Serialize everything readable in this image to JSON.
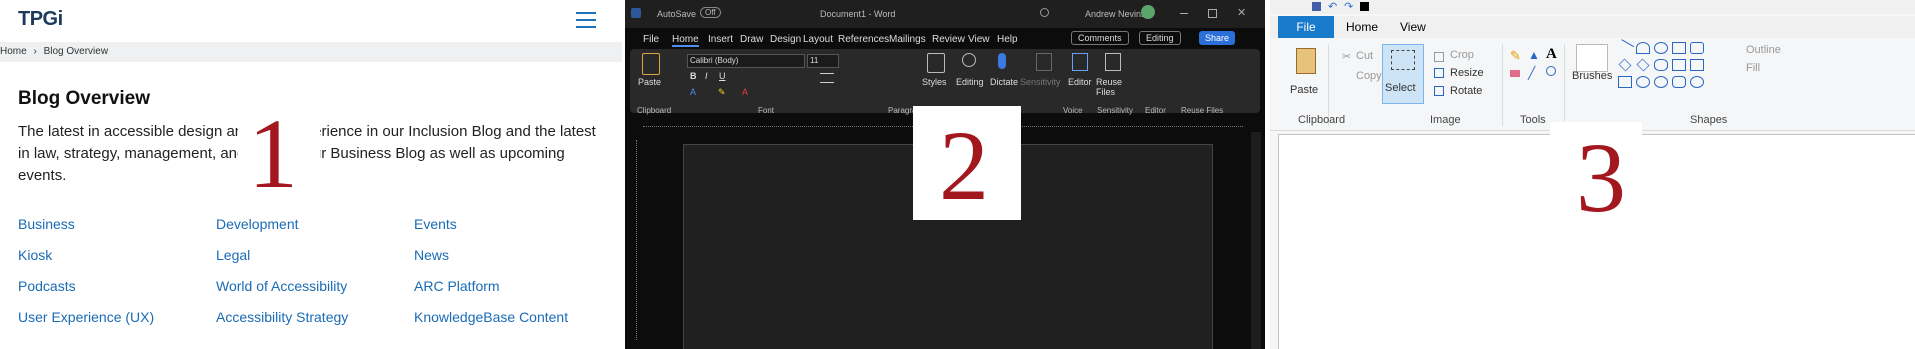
{
  "panel1": {
    "logo": "TPGi",
    "breadcrumb": [
      "Home",
      "›",
      "Blog Overview"
    ],
    "title": "Blog Overview",
    "description": "The latest in accessible design and user experience in our Inclusion Blog and the latest in law, strategy, management, and news in our Business Blog as well as upcoming events.",
    "links": [
      [
        "Business",
        "Development",
        "Events"
      ],
      [
        "Kiosk",
        "Legal",
        "News"
      ],
      [
        "Podcasts",
        "World of Accessibility",
        "ARC Platform"
      ],
      [
        "User Experience (UX)",
        "Accessibility Strategy",
        "KnowledgeBase Content"
      ]
    ],
    "overlay_number": "1"
  },
  "panel2": {
    "titlebar": {
      "autosave": "AutoSave",
      "autosave_state": "Off",
      "doc": "Document1 - Word",
      "user": "Andrew Nevins"
    },
    "tabs": [
      "File",
      "Home",
      "Insert",
      "Draw",
      "Design",
      "Layout",
      "References",
      "Mailings",
      "Review",
      "View",
      "Help"
    ],
    "buttons": {
      "comments": "Comments",
      "editing": "Editing",
      "share": "Share"
    },
    "font_name": "Calibri (Body)",
    "font_size": "11",
    "ribbon_items": {
      "paste": "Paste",
      "styles": "Styles",
      "editing": "Editing",
      "dictate": "Dictate",
      "sensitivity": "Sensitivity",
      "editor": "Editor",
      "reuse": "Reuse Files"
    },
    "groups": [
      "Clipboard",
      "Font",
      "Paragraph",
      "Voice",
      "Sensitivity",
      "Editor",
      "Reuse Files"
    ],
    "overlay_number": "2"
  },
  "panel3": {
    "tabs": [
      "File",
      "Home",
      "View"
    ],
    "clipboard": {
      "paste": "Paste",
      "cut": "Cut",
      "copy": "Copy"
    },
    "image": {
      "select": "Select",
      "crop": "Crop",
      "resize": "Resize",
      "rotate": "Rotate"
    },
    "brushes": "Brushes",
    "outline": "Outline",
    "fill": "Fill",
    "groups": [
      "Clipboard",
      "Image",
      "Tools",
      "Shapes"
    ],
    "overlay_number": "3"
  }
}
